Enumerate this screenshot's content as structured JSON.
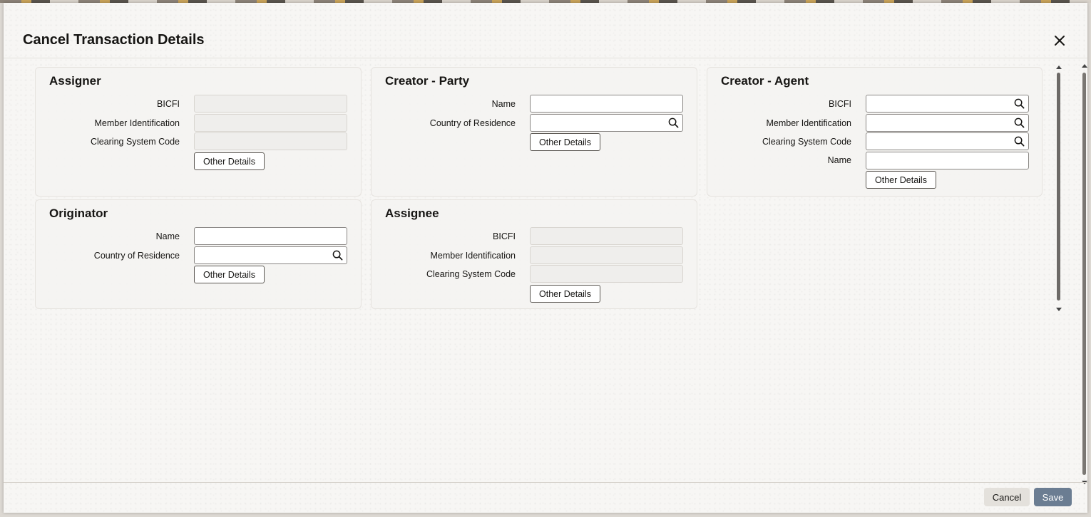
{
  "dialog": {
    "title": "Cancel Transaction Details",
    "close_icon": "close-icon"
  },
  "panels": {
    "assigner": {
      "title": "Assigner",
      "bicfi_label": "BICFI",
      "member_id_label": "Member Identification",
      "clearing_code_label": "Clearing System Code",
      "bicfi_value": "",
      "member_id_value": "",
      "clearing_code_value": "",
      "other_details_label": "Other Details"
    },
    "creator_party": {
      "title": "Creator - Party",
      "name_label": "Name",
      "country_label": "Country of Residence",
      "name_value": "",
      "country_value": "",
      "other_details_label": "Other Details"
    },
    "creator_agent": {
      "title": "Creator - Agent",
      "bicfi_label": "BICFI",
      "member_id_label": "Member Identification",
      "clearing_code_label": "Clearing System Code",
      "name_label": "Name",
      "bicfi_value": "",
      "member_id_value": "",
      "clearing_code_value": "",
      "name_value": "",
      "other_details_label": "Other Details"
    },
    "originator": {
      "title": "Originator",
      "name_label": "Name",
      "country_label": "Country of Residence",
      "name_value": "",
      "country_value": "",
      "other_details_label": "Other Details"
    },
    "assignee": {
      "title": "Assignee",
      "bicfi_label": "BICFI",
      "member_id_label": "Member Identification",
      "clearing_code_label": "Clearing System Code",
      "bicfi_value": "",
      "member_id_value": "",
      "clearing_code_value": "",
      "other_details_label": "Other Details"
    }
  },
  "footer": {
    "cancel_label": "Cancel",
    "save_label": "Save"
  },
  "colors": {
    "save_button": "#6b7d92",
    "cancel_button": "#e4e1dc",
    "text": "#161513"
  }
}
